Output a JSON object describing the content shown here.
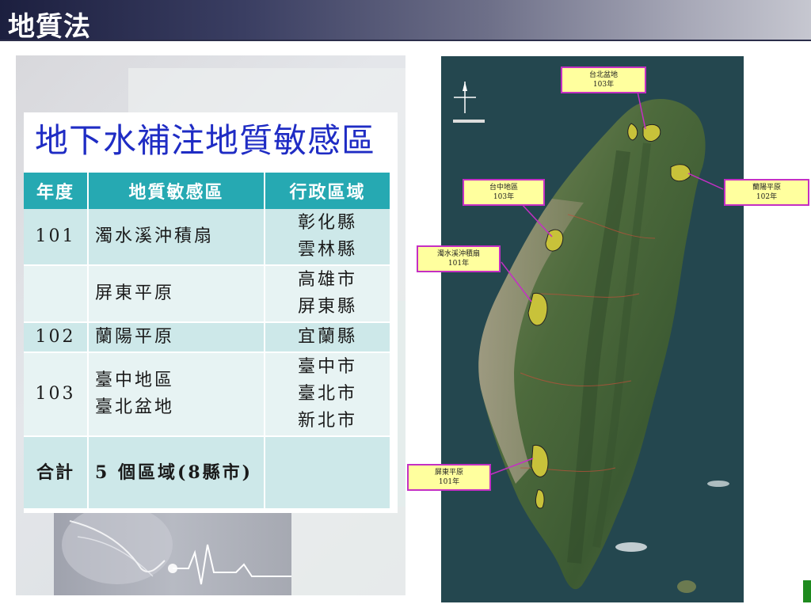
{
  "slide": {
    "title": "地質法"
  },
  "card": {
    "title": "地下水補注地質敏感區",
    "table": {
      "headers": [
        "年度",
        "地質敏感區",
        "行政區域"
      ],
      "rows": [
        {
          "year": "101",
          "area": "濁水溪沖積扇",
          "admin": [
            "彰化縣",
            "雲林縣"
          ]
        },
        {
          "year": "",
          "area": "屏東平原",
          "admin": [
            "高雄市",
            "屏東縣"
          ]
        },
        {
          "year": "102",
          "area": "蘭陽平原",
          "admin": [
            "宜蘭縣"
          ]
        },
        {
          "year": "103",
          "area": [
            "臺中地區",
            "臺北盆地"
          ],
          "admin": [
            "臺中市",
            "臺北市",
            "新北市"
          ]
        },
        {
          "year": "合計",
          "area": "5 個區域(8縣市)",
          "admin": []
        }
      ]
    }
  },
  "map": {
    "labels": {
      "taipei": {
        "name": "台北盆地",
        "year": "103年"
      },
      "taichung": {
        "name": "台中地區",
        "year": "103年"
      },
      "yilan": {
        "name": "蘭陽平原",
        "year": "102年"
      },
      "zhuoshui": {
        "name": "濁水溪沖積扇",
        "year": "101年"
      },
      "pingtung": {
        "name": "屏東平原",
        "year": "101年"
      }
    }
  },
  "colors": {
    "header_dark": "#1c1f3f",
    "title_blue": "#1f2cc4",
    "table_header": "#26a9b2",
    "row_dark": "#cde8e9",
    "row_light": "#e7f3f3",
    "label_fill": "#ffff9e",
    "label_border": "#c42fc4",
    "zone_fill": "#c8c23a"
  }
}
